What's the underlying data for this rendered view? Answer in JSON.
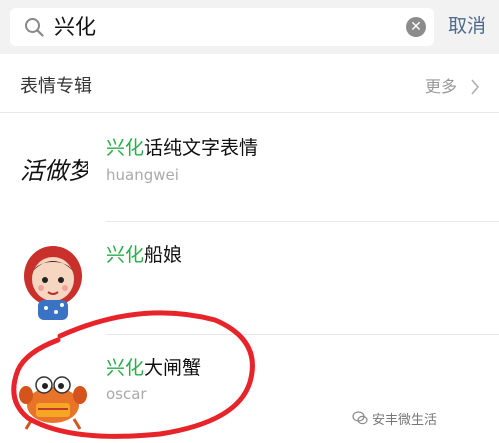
{
  "search": {
    "query": "兴化",
    "cancel_label": "取消"
  },
  "section": {
    "title": "表情专辑",
    "more_label": "更多"
  },
  "items": [
    {
      "highlight": "兴化",
      "title_rest": "话纯文字表情",
      "subtitle": "huangwei",
      "thumb_text": "活做梦"
    },
    {
      "highlight": "兴化",
      "title_rest": "船娘",
      "subtitle": ""
    },
    {
      "highlight": "兴化",
      "title_rest": "大闸蟹",
      "subtitle": "oscar"
    }
  ],
  "watermark": {
    "text": "安丰微生活"
  },
  "colors": {
    "highlight": "#2aae49",
    "cancel": "#4e6a8f",
    "annotation": "#e8242b"
  }
}
